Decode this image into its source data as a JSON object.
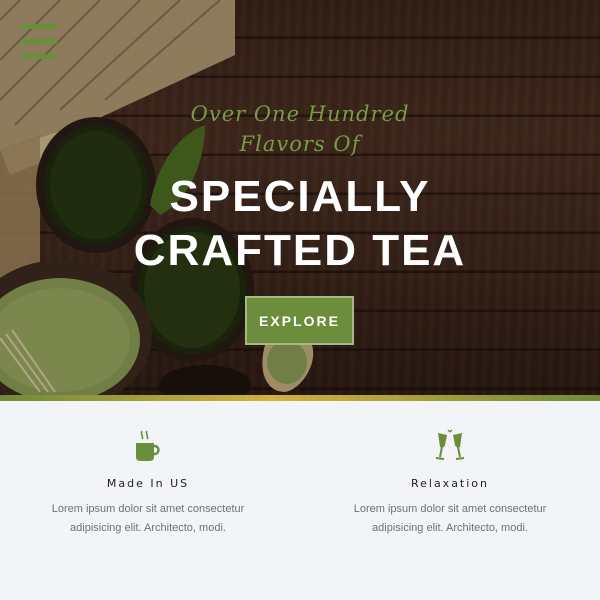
{
  "nav": {
    "menu_icon": "hamburger-icon"
  },
  "hero": {
    "tagline": "Over One Hundred Flavors Of",
    "headline": "SPECIALLY CRAFTED TEA",
    "cta_label": "EXPLORE"
  },
  "colors": {
    "accent_green": "#6c8d3b",
    "tagline_green": "#7a9b45",
    "gold": "#d4b03e",
    "wood_dark": "#3b2419",
    "section_bg": "#f2f4f7"
  },
  "features": [
    {
      "icon": "coffee-cup-icon",
      "title": "Made In US",
      "desc": "Lorem ipsum dolor sit amet consectetur adipisicing elit. Architecto, modi."
    },
    {
      "icon": "champagne-glasses-icon",
      "title": "Relaxation",
      "desc": "Lorem ipsum dolor sit amet consectetur adipisicing elit. Architecto, modi."
    }
  ]
}
